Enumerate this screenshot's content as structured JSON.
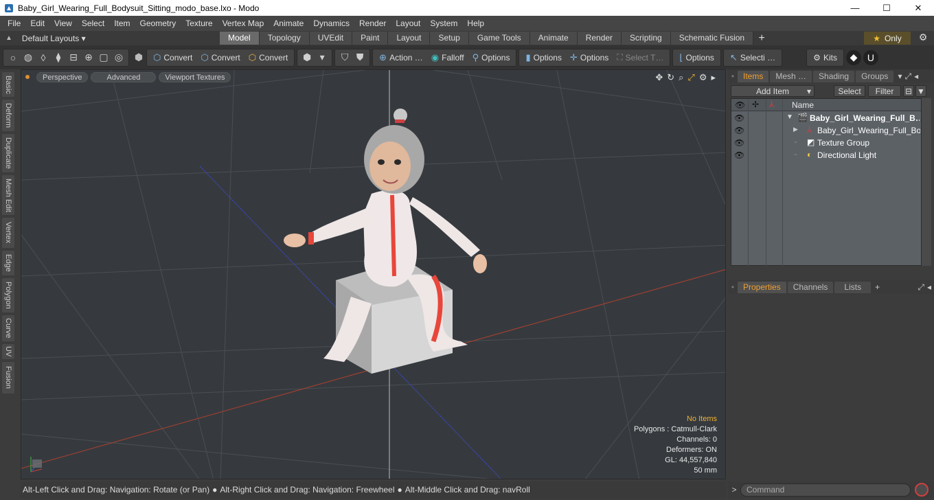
{
  "window": {
    "title": "Baby_Girl_Wearing_Full_Bodysuit_Sitting_modo_base.lxo - Modo",
    "minimize": "—",
    "maximize": "☐",
    "close": "✕"
  },
  "menu": [
    "File",
    "Edit",
    "View",
    "Select",
    "Item",
    "Geometry",
    "Texture",
    "Vertex Map",
    "Animate",
    "Dynamics",
    "Render",
    "Layout",
    "System",
    "Help"
  ],
  "layoutbar": {
    "layout_label": "Default Layouts ▾",
    "tabs": [
      "Model",
      "Topology",
      "UVEdit",
      "Paint",
      "Layout",
      "Setup",
      "Game Tools",
      "Animate",
      "Render",
      "Scripting",
      "Schematic Fusion"
    ],
    "active_tab": "Model",
    "only_label": "Only"
  },
  "toolbar": {
    "convert1": "Convert",
    "convert2": "Convert",
    "convert3": "Convert",
    "action": "Action …",
    "falloff": "Falloff",
    "options1": "Options",
    "options2": "Options",
    "options3": "Options",
    "select_t": "Select T…",
    "options4": "Options",
    "selecti": "Selecti …",
    "kits": "Kits"
  },
  "left_tabs": [
    "Basic",
    "Deform",
    "Duplicate",
    "Mesh Edit",
    "Vertex",
    "Edge",
    "Polygon",
    "Curve",
    "UV",
    "Fusion"
  ],
  "viewport": {
    "perspective": "Perspective",
    "advanced": "Advanced",
    "viewport_textures": "Viewport Textures",
    "info": {
      "no_items": "No Items",
      "polygons": "Polygons : Catmull-Clark",
      "channels": "Channels: 0",
      "deformers": "Deformers: ON",
      "gl": "GL: 44,557,840",
      "scale": "50 mm"
    }
  },
  "statusbar": {
    "hint1": "Alt-Left Click and Drag: Navigation: Rotate (or Pan)",
    "hint2": "Alt-Right Click and Drag: Navigation: Freewheel",
    "hint3": "Alt-Middle Click and Drag: navRoll"
  },
  "items_panel": {
    "tabs": [
      "Items",
      "Mesh …",
      "Shading",
      "Groups"
    ],
    "active_tab": "Items",
    "add_item": "Add Item",
    "select": "Select",
    "filter": "Filter",
    "name_header": "Name",
    "rows": [
      {
        "name": "Baby_Girl_Wearing_Full_B…",
        "bold": true
      },
      {
        "name": "Baby_Girl_Wearing_Full_Bod…",
        "bold": false
      },
      {
        "name": "Texture Group",
        "bold": false
      },
      {
        "name": "Directional Light",
        "bold": false
      }
    ]
  },
  "props_panel": {
    "tabs": [
      "Properties",
      "Channels",
      "Lists"
    ],
    "active_tab": "Properties"
  },
  "command": {
    "placeholder": "Command"
  },
  "colors": {
    "accent": "#f0a030",
    "viewport_bg": "#363a3e",
    "x_axis": "#c04030",
    "z_axis": "#3040c0"
  }
}
